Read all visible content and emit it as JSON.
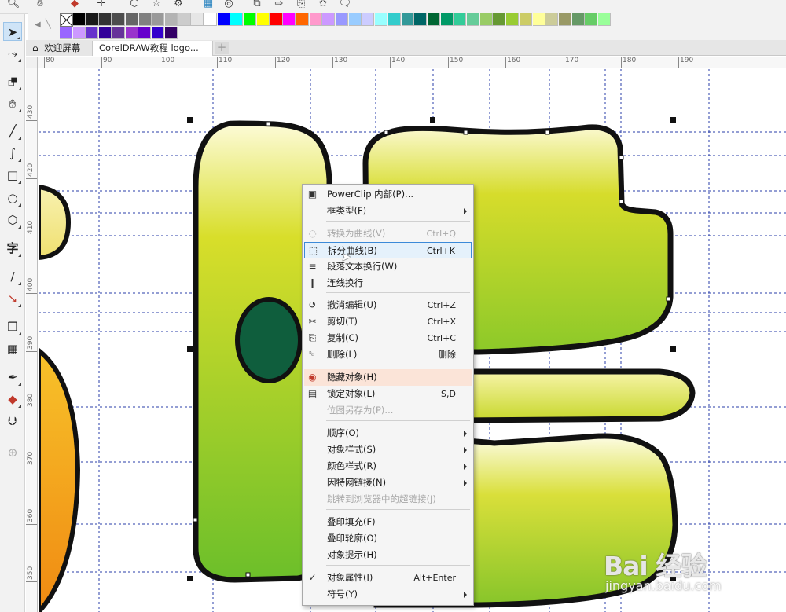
{
  "tabs": {
    "welcome_label": "欢迎屏幕",
    "document_label": "CorelDRAW教程 logo...",
    "add_label": "+"
  },
  "rulers": {
    "horizontal": [
      "80",
      "90",
      "100",
      "110",
      "120",
      "130",
      "140",
      "150",
      "160",
      "170",
      "180",
      "190"
    ],
    "vertical": [
      "430",
      "420",
      "410",
      "400",
      "390",
      "380",
      "370",
      "360",
      "350"
    ]
  },
  "palette": {
    "colors": [
      "#000000",
      "#1a1a1a",
      "#333333",
      "#4d4d4d",
      "#666666",
      "#808080",
      "#999999",
      "#b3b3b3",
      "#cccccc",
      "#e6e6e6",
      "#ffffff",
      "#0000ff",
      "#00ffff",
      "#00ff00",
      "#ffff00",
      "#ff0000",
      "#ff00ff",
      "#ff6600",
      "#ff99cc",
      "#cc99ff",
      "#9999ff",
      "#99ccff",
      "#ccccff",
      "#99ffff",
      "#33cccc",
      "#339999",
      "#006666",
      "#006633",
      "#009966",
      "#33cc99",
      "#66cc99",
      "#99cc66",
      "#669933",
      "#99cc33",
      "#cccc66",
      "#ffff99",
      "#cccc99",
      "#999966",
      "#669966",
      "#66cc66",
      "#99ff99"
    ],
    "colors_row2": [
      "#9966ff",
      "#cc99ff",
      "#6633cc",
      "#330099",
      "#663399",
      "#9933cc",
      "#6600cc",
      "#3300cc",
      "#330066"
    ]
  },
  "toolbox_icons": [
    "pick-tool",
    "shape-tool",
    "crop-tool",
    "pan-tool",
    "freehand-tool",
    "artistic-media-tool",
    "rectangle-tool",
    "ellipse-tool",
    "polygon-tool",
    "text-tool",
    "parallel-dimension-tool",
    "connector-tool",
    "drop-shadow-tool",
    "transparency-tool",
    "eyedropper-tool",
    "interactive-fill-tool",
    "smart-fill-tool",
    "add-tool"
  ],
  "context_menu": {
    "items": [
      {
        "label": "PowerClip 内部(P)...",
        "shortcut": "",
        "submenu": false,
        "disabled": false,
        "icon": "powerclip-icon"
      },
      {
        "label": "框类型(F)",
        "shortcut": "",
        "submenu": true,
        "disabled": false,
        "icon": ""
      },
      {
        "label": "转换为曲线(V)",
        "shortcut": "Ctrl+Q",
        "submenu": false,
        "disabled": true,
        "icon": "convert-to-curves-icon"
      },
      {
        "label": "拆分曲线(B)",
        "shortcut": "Ctrl+K",
        "submenu": false,
        "disabled": false,
        "icon": "break-apart-icon"
      },
      {
        "label": "段落文本换行(W)",
        "shortcut": "",
        "submenu": false,
        "disabled": false,
        "icon": "text-wrap-icon"
      },
      {
        "label": "连线换行",
        "shortcut": "",
        "submenu": false,
        "disabled": false,
        "icon": "line-wrap-icon"
      },
      {
        "label": "撤消编辑(U)",
        "shortcut": "Ctrl+Z",
        "submenu": false,
        "disabled": false,
        "icon": "undo-icon"
      },
      {
        "label": "剪切(T)",
        "shortcut": "Ctrl+X",
        "submenu": false,
        "disabled": false,
        "icon": "cut-icon"
      },
      {
        "label": "复制(C)",
        "shortcut": "Ctrl+C",
        "submenu": false,
        "disabled": false,
        "icon": "copy-icon"
      },
      {
        "label": "删除(L)",
        "shortcut": "删除",
        "submenu": false,
        "disabled": false,
        "icon": "delete-icon"
      },
      {
        "label": "隐藏对象(H)",
        "shortcut": "",
        "submenu": false,
        "disabled": false,
        "icon": "hide-object-icon"
      },
      {
        "label": "锁定对象(L)",
        "shortcut": "S,D",
        "submenu": false,
        "disabled": false,
        "icon": "lock-icon"
      },
      {
        "label": "位图另存为(P)...",
        "shortcut": "",
        "submenu": false,
        "disabled": true,
        "icon": ""
      },
      {
        "label": "顺序(O)",
        "shortcut": "",
        "submenu": true,
        "disabled": false,
        "icon": ""
      },
      {
        "label": "对象样式(S)",
        "shortcut": "",
        "submenu": true,
        "disabled": false,
        "icon": ""
      },
      {
        "label": "颜色样式(R)",
        "shortcut": "",
        "submenu": true,
        "disabled": false,
        "icon": ""
      },
      {
        "label": "因特网链接(N)",
        "shortcut": "",
        "submenu": true,
        "disabled": false,
        "icon": ""
      },
      {
        "label": "跳转到浏览器中的超链接(J)",
        "shortcut": "",
        "submenu": false,
        "disabled": true,
        "icon": ""
      },
      {
        "label": "叠印填充(F)",
        "shortcut": "",
        "submenu": false,
        "disabled": false,
        "icon": ""
      },
      {
        "label": "叠印轮廓(O)",
        "shortcut": "",
        "submenu": false,
        "disabled": false,
        "icon": ""
      },
      {
        "label": "对象提示(H)",
        "shortcut": "",
        "submenu": false,
        "disabled": false,
        "icon": ""
      },
      {
        "label": "对象属性(I)",
        "shortcut": "Alt+Enter",
        "submenu": false,
        "disabled": false,
        "icon": "checkmark-icon"
      },
      {
        "label": "符号(Y)",
        "shortcut": "",
        "submenu": true,
        "disabled": false,
        "icon": ""
      }
    ]
  },
  "watermark": {
    "logo": "Bai 经验",
    "url": "jingyan.baidu.com"
  },
  "colors": {
    "shape_top": "#fdfbd8",
    "shape_mid": "#cfd92a",
    "shape_bottom": "#6cbf2a",
    "ellipse_fill": "#0f5e3d",
    "orange_fill": "#f2a21a",
    "hover_border": "#3c8ad8",
    "highlight_tint": "#fbe4d8"
  }
}
